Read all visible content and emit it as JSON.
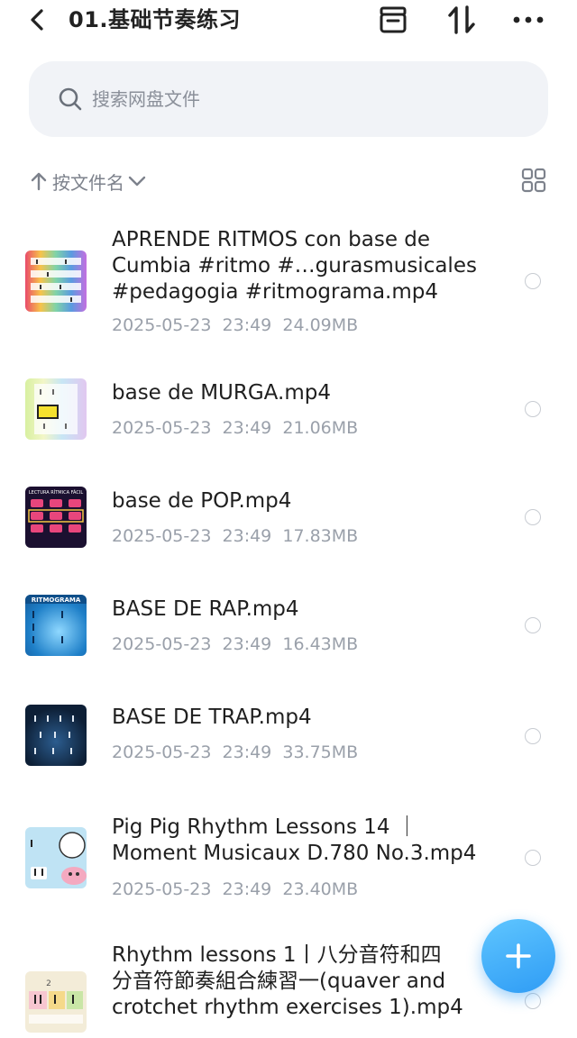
{
  "header": {
    "title": "01.基础节奏练习"
  },
  "search": {
    "placeholder": "搜索网盘文件"
  },
  "sort": {
    "label": "按文件名"
  },
  "files": [
    {
      "name_lines": [
        "APRENDE RITMOS con base de",
        "Cumbia #ritmo #…gurasmusicales",
        "#pedagogia #ritmograma.mp4"
      ],
      "date": "2025-05-23",
      "time": "23:49",
      "size": "24.09MB",
      "thumb_label": ""
    },
    {
      "name_lines": [
        "base de MURGA.mp4"
      ],
      "date": "2025-05-23",
      "time": "23:49",
      "size": "21.06MB",
      "thumb_label": ""
    },
    {
      "name_lines": [
        "base de POP.mp4"
      ],
      "date": "2025-05-23",
      "time": "23:49",
      "size": "17.83MB",
      "thumb_label": "LECTURA RÍTMICA FÁCIL"
    },
    {
      "name_lines": [
        "BASE DE RAP.mp4"
      ],
      "date": "2025-05-23",
      "time": "23:49",
      "size": "16.43MB",
      "thumb_label": "RITMOGRAMA"
    },
    {
      "name_lines": [
        "BASE DE TRAP.mp4"
      ],
      "date": "2025-05-23",
      "time": "23:49",
      "size": "33.75MB",
      "thumb_label": ""
    },
    {
      "name_lines": [
        "Pig Pig Rhythm Lessons 14 ｜",
        "Moment Musicaux D.780 No.3.mp4"
      ],
      "date": "2025-05-23",
      "time": "23:49",
      "size": "23.40MB",
      "thumb_label": ""
    },
    {
      "name_lines": [
        "Rhythm lessons 1丨八分音符和四",
        "分音符節奏組合練習一(quaver and",
        "crotchet  rhythm  exercises 1).mp4"
      ],
      "date": "",
      "time": "",
      "size": "",
      "thumb_label": "2"
    }
  ],
  "colors": {
    "accent": "#2f9cf5",
    "search_bg": "#f1f3f7",
    "meta_text": "#9aa0aa"
  },
  "icons": {
    "back": "chevron-left-icon",
    "archive": "archive-box-icon",
    "sort_toggle": "sort-arrows-icon",
    "more": "more-dots-icon",
    "search": "search-icon",
    "sort_direction": "arrow-up-icon",
    "sort_dropdown": "chevron-down-icon",
    "view_mode": "grid-view-icon",
    "fab": "plus-icon"
  }
}
